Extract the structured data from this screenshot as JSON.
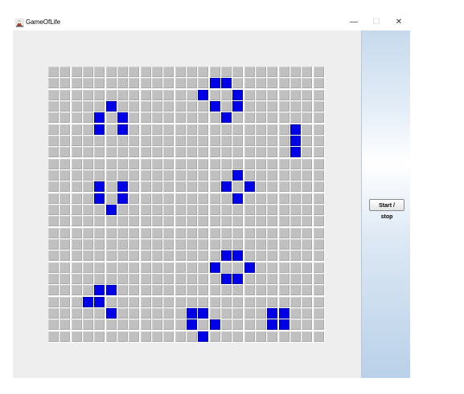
{
  "window": {
    "title": "GameOfLife",
    "app_icon": "java-duke-icon",
    "controls": {
      "minimize": "—",
      "maximize": "☐",
      "close": "✕"
    }
  },
  "controls": {
    "start_stop_label": "Start / stop"
  },
  "board": {
    "rows": 24,
    "cols": 24,
    "alive_color": "#0000e6",
    "dead_color": "#c0c0c0",
    "alive_cells": [
      [
        1,
        14
      ],
      [
        1,
        15
      ],
      [
        2,
        13
      ],
      [
        2,
        16
      ],
      [
        3,
        5
      ],
      [
        3,
        14
      ],
      [
        3,
        16
      ],
      [
        4,
        4
      ],
      [
        4,
        6
      ],
      [
        4,
        15
      ],
      [
        5,
        4
      ],
      [
        5,
        6
      ],
      [
        5,
        21
      ],
      [
        6,
        21
      ],
      [
        7,
        21
      ],
      [
        9,
        16
      ],
      [
        10,
        4
      ],
      [
        10,
        6
      ],
      [
        10,
        15
      ],
      [
        10,
        17
      ],
      [
        11,
        4
      ],
      [
        11,
        6
      ],
      [
        11,
        16
      ],
      [
        12,
        5
      ],
      [
        16,
        15
      ],
      [
        16,
        16
      ],
      [
        17,
        14
      ],
      [
        17,
        17
      ],
      [
        18,
        15
      ],
      [
        18,
        16
      ],
      [
        19,
        4
      ],
      [
        19,
        5
      ],
      [
        20,
        3
      ],
      [
        20,
        4
      ],
      [
        21,
        5
      ],
      [
        21,
        12
      ],
      [
        21,
        13
      ],
      [
        21,
        19
      ],
      [
        21,
        20
      ],
      [
        22,
        12
      ],
      [
        22,
        14
      ],
      [
        22,
        19
      ],
      [
        22,
        20
      ],
      [
        23,
        13
      ]
    ]
  }
}
